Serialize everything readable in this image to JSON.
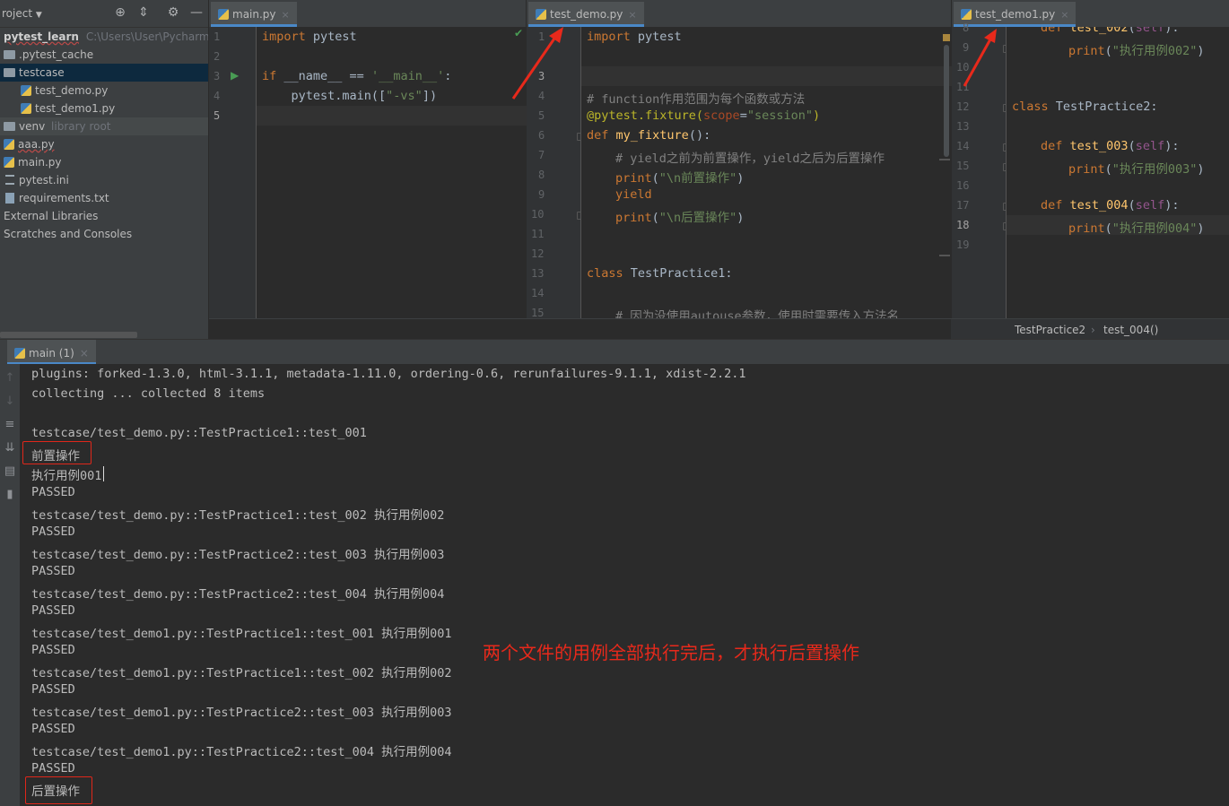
{
  "project": {
    "title": "roject",
    "header_icons": [
      "target-icon",
      "collapse-icon",
      "gear-icon",
      "minimize-icon"
    ],
    "tree": [
      {
        "label": "pytest_learn",
        "extra": "C:\\Users\\User\\PycharmPr",
        "type": "root"
      },
      {
        "label": ".pytest_cache",
        "type": "folder"
      },
      {
        "label": "testcase",
        "type": "folder",
        "selected": true
      },
      {
        "label": "test_demo.py",
        "type": "py"
      },
      {
        "label": "test_demo1.py",
        "type": "py"
      },
      {
        "label": "venv",
        "extra": "library root",
        "type": "folder"
      },
      {
        "label": "aaa.py",
        "type": "py"
      },
      {
        "label": "main.py",
        "type": "py"
      },
      {
        "label": "pytest.ini",
        "type": "ini"
      },
      {
        "label": "requirements.txt",
        "type": "txt"
      },
      {
        "label": "External Libraries",
        "type": "lib"
      },
      {
        "label": "Scratches and Consoles",
        "type": "lib"
      }
    ]
  },
  "editors": {
    "main": {
      "tab": "main.py"
    },
    "demo": {
      "tab": "test_demo.py"
    },
    "demo1": {
      "tab": "test_demo1.py"
    },
    "breadcrumb": [
      "TestPractice2",
      "test_004()"
    ]
  },
  "code": {
    "main_pytest": "pytest",
    "main_if": "if",
    "main_name": " __name__ == ",
    "main_str": "'__main__'",
    "main_colon": ":",
    "main_call": "    pytest.main([",
    "main_arg": "\"-vs\"",
    "main_close": "])",
    "kw_import": "import",
    "demo_comment1": "# function作用范围为每个函数或方法",
    "demo_dec": "@pytest.fixture(",
    "demo_scope": "scope",
    "demo_eq": "=",
    "demo_session": "\"session\"",
    "demo_paren": ")",
    "kw_def": "def",
    "demo_fn": "my_fixture",
    "demo_fn_tail": "():",
    "demo_comment2": "# yield之前为前置操作，yield之后为后置操作",
    "print": "print",
    "demo_pre": "\"\\n前置操作\"",
    "kw_yield": "yield",
    "demo_post": "\"\\n后置操作\"",
    "kw_class": "class",
    "demo_cls": " TestPractice1:",
    "demo_comment3": "# 因为没使用autouse参数，使用时需要传入方法名",
    "d1_def002": "test_002",
    "self": "self",
    "d1_s002": "\"执行用例002\"",
    "d1_cls": " TestPractice2:",
    "d1_f003": "test_003",
    "d1_s003": "\"执行用例003\"",
    "d1_f004": "test_004",
    "d1_s004": "\"执行用例004\"",
    "paren_open": "(",
    "paren_close": ")",
    "def_tail": "):"
  },
  "run": {
    "tab": "main (1)",
    "console": [
      "plugins: forked-1.3.0, html-3.1.1, metadata-1.11.0, ordering-0.6, rerunfailures-9.1.1, xdist-2.2.1",
      "collecting ... collected 8 items",
      "",
      "testcase/test_demo.py::TestPractice1::test_001",
      "前置操作",
      "执行用例001",
      "PASSED",
      "testcase/test_demo.py::TestPractice1::test_002 执行用例002",
      "PASSED",
      "testcase/test_demo.py::TestPractice2::test_003 执行用例003",
      "PASSED",
      "testcase/test_demo.py::TestPractice2::test_004 执行用例004",
      "PASSED",
      "testcase/test_demo1.py::TestPractice1::test_001 执行用例001",
      "PASSED",
      "testcase/test_demo1.py::TestPractice1::test_002 执行用例002",
      "PASSED",
      "testcase/test_demo1.py::TestPractice2::test_003 执行用例003",
      "PASSED",
      "testcase/test_demo1.py::TestPractice2::test_004 执行用例004",
      "PASSED",
      "后置操作"
    ],
    "annotation": "两个文件的用例全部执行完后，才执行后置操作"
  },
  "colors": {
    "annotation": "#e8291b",
    "tab_underline": "#4a88c7"
  }
}
